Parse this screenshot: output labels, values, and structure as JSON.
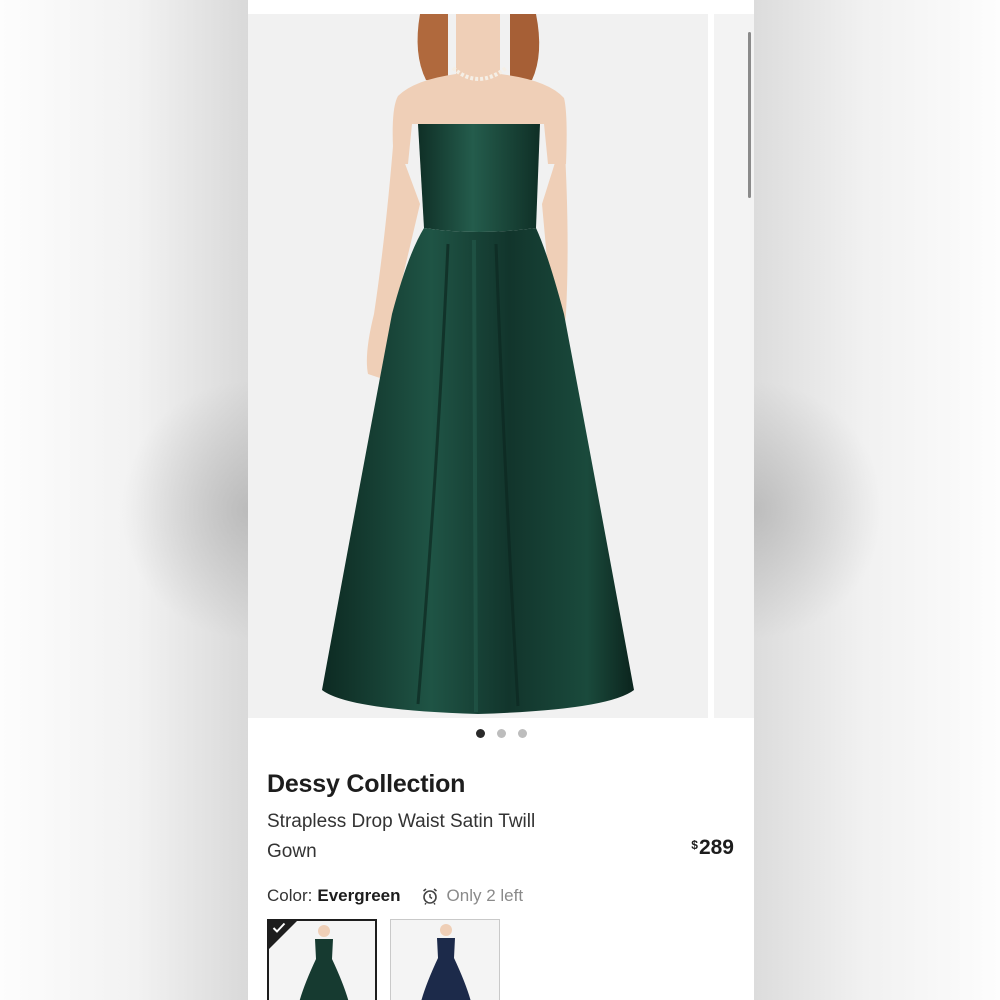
{
  "product": {
    "brand": "Dessy Collection",
    "name": "Strapless Drop Waist Satin Twill Gown",
    "price_symbol": "$",
    "price": "289"
  },
  "gallery": {
    "slide_count": 3,
    "active_slide": 1
  },
  "color": {
    "label": "Color:",
    "value": "Evergreen",
    "stock_text": "Only 2 left",
    "stock_icon": "alarm-clock-icon"
  },
  "swatches": [
    {
      "name": "Evergreen",
      "selected": true,
      "color": "#163a30"
    },
    {
      "name": "Midnight Navy",
      "selected": false,
      "color": "#1c2a4a"
    }
  ],
  "colors": {
    "dress": "#12352c",
    "dress_highlight": "#1f5445",
    "skin": "#efcfb7",
    "hair": "#b0693d",
    "text": "#1d1d1d",
    "muted": "#8a8a8a"
  }
}
